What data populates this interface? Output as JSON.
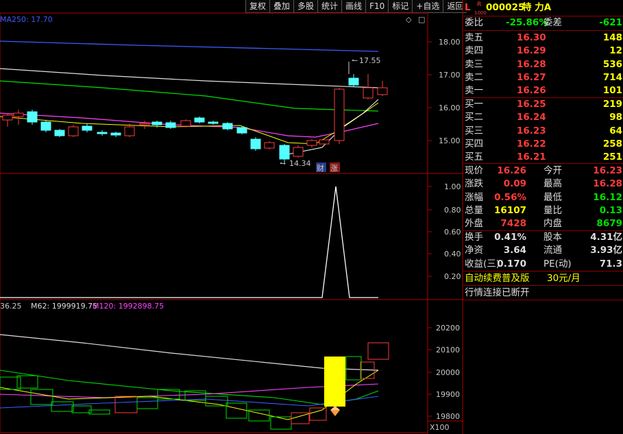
{
  "toolbar": [
    "复权",
    "叠加",
    "多股",
    "统计",
    "画线",
    "F10",
    "标记",
    "+自选",
    "返回"
  ],
  "stock": {
    "prefix": "L",
    "sup": "R",
    "sub": "1000",
    "code": "000025",
    "name": "特 力A"
  },
  "colors": {
    "up": "#ff3b3b",
    "down": "#54ffff",
    "neutral": "#ffffff",
    "yellow": "#ffff00",
    "green": "#00e000",
    "blue": "#3a5dff",
    "magenta": "#ff44ff"
  },
  "top_chart": {
    "ma_label": "MA250: 17.70",
    "y_ticks": [
      "18.00",
      "17.00",
      "16.00",
      "15.00"
    ],
    "high_label": "17.55",
    "low_label": "14.34",
    "tags": [
      "财",
      "涨"
    ]
  },
  "mid_chart": {
    "y_ticks": [
      "1.00",
      "0.80",
      "0.60",
      "0.40",
      "0.20"
    ]
  },
  "bottom_chart": {
    "legend_a": "36.25",
    "legend_b": "M62: 1999919.75",
    "legend_c": "M120: 1992898.75",
    "y_ticks": [
      "20200",
      "20100",
      "20000",
      "19900",
      "19800"
    ],
    "unit": "X100"
  },
  "quote": {
    "weibi": {
      "label": "委比",
      "value": "-25.86%",
      "label2": "委差",
      "value2": "-621"
    },
    "sell": [
      {
        "label": "卖五",
        "price": "16.30",
        "vol": "148"
      },
      {
        "label": "卖四",
        "price": "16.29",
        "vol": "12"
      },
      {
        "label": "卖三",
        "price": "16.28",
        "vol": "536"
      },
      {
        "label": "卖二",
        "price": "16.27",
        "vol": "714"
      },
      {
        "label": "卖一",
        "price": "16.26",
        "vol": "101"
      }
    ],
    "buy": [
      {
        "label": "买一",
        "price": "16.25",
        "vol": "219"
      },
      {
        "label": "买二",
        "price": "16.24",
        "vol": "98"
      },
      {
        "label": "买三",
        "price": "16.23",
        "vol": "64"
      },
      {
        "label": "买四",
        "price": "16.22",
        "vol": "258"
      },
      {
        "label": "买五",
        "price": "16.21",
        "vol": "251"
      }
    ],
    "stats": [
      {
        "l1": "现价",
        "v1": "16.26",
        "l2": "今开",
        "v2": "16.23"
      },
      {
        "l1": "涨跌",
        "v1": "0.09",
        "l2": "最高",
        "v2": "16.28"
      },
      {
        "l1": "涨幅",
        "v1": "0.56%",
        "l2": "最低",
        "v2": "16.12"
      },
      {
        "l1": "总量",
        "v1": "16107",
        "l2": "量比",
        "v2": "0.13"
      },
      {
        "l1": "外盘",
        "v1": "7428",
        "l2": "内盘",
        "v2": "8679"
      }
    ],
    "fin": [
      {
        "l1": "换手",
        "v1": "0.41%",
        "l2": "股本",
        "v2": "4.31亿"
      },
      {
        "l1": "净资",
        "v1": "3.64",
        "l2": "流通",
        "v2": "3.93亿"
      },
      {
        "l1": "收益(三)",
        "v1": "0.170",
        "l2": "PE(动)",
        "v2": "71.3"
      }
    ],
    "promo_a": "自动续费普及版",
    "promo_b": "30元/月",
    "conn_status": "行情连接已断开"
  }
}
